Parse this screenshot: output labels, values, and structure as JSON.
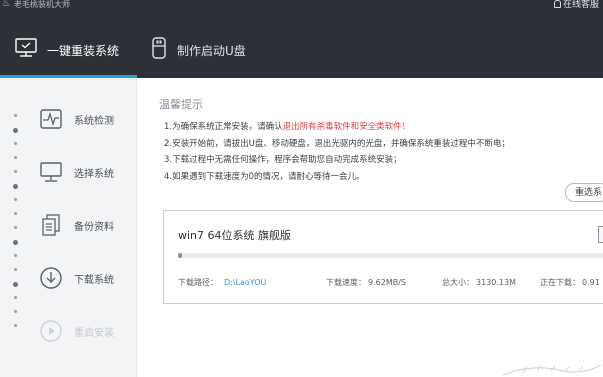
{
  "app": {
    "title": "老毛桃装机大师",
    "support": "在线客服"
  },
  "tabs": [
    {
      "label": "一键重装系统",
      "icon": "monitor-icon",
      "active": true
    },
    {
      "label": "制作启动U盘",
      "icon": "usb-drive-icon",
      "active": false
    }
  ],
  "steps": [
    {
      "label": "系统检测",
      "icon": "pulse-monitor-icon",
      "enabled": true
    },
    {
      "label": "选择系统",
      "icon": "desktop-icon",
      "enabled": true
    },
    {
      "label": "备份资料",
      "icon": "documents-icon",
      "enabled": true
    },
    {
      "label": "下载系统",
      "icon": "download-icon",
      "enabled": true
    },
    {
      "label": "重启安装",
      "icon": "restart-icon",
      "enabled": false
    }
  ],
  "notice": {
    "title": "温馨提示",
    "line1_pre": "1.为确保系统正常安装，请确认",
    "line1_hl": "退出所有杀毒软件和安全类软件！",
    "line2": "2.安装开始前，请拔出U盘、移动硬盘，退出光驱内的光盘，并确保系统重装过程中不断电；",
    "line3": "3.下载过程中无需任何操作，程序会帮助您自动完成系统安装；",
    "line4": "4.如果遇到下载速度为0的情况，请耐心等待一会儿。"
  },
  "reselect_label": "重选系",
  "download": {
    "system_name": "win7 64位系统 旗舰版",
    "progress_fraction": 0.01,
    "path_label": "下载路径：",
    "path_value": "D:\\LaoYOU",
    "speed_label": "下载速度：",
    "speed_value": "9.62MB/S",
    "size_label": "总大小：",
    "size_value": "3130.13M",
    "status_label": "正在下载：",
    "status_value": "0.91"
  },
  "colors": {
    "header_bg": "#2d3036",
    "accent": "#1fa0e2",
    "highlight": "#e0403a",
    "link": "#3c8fd6"
  }
}
